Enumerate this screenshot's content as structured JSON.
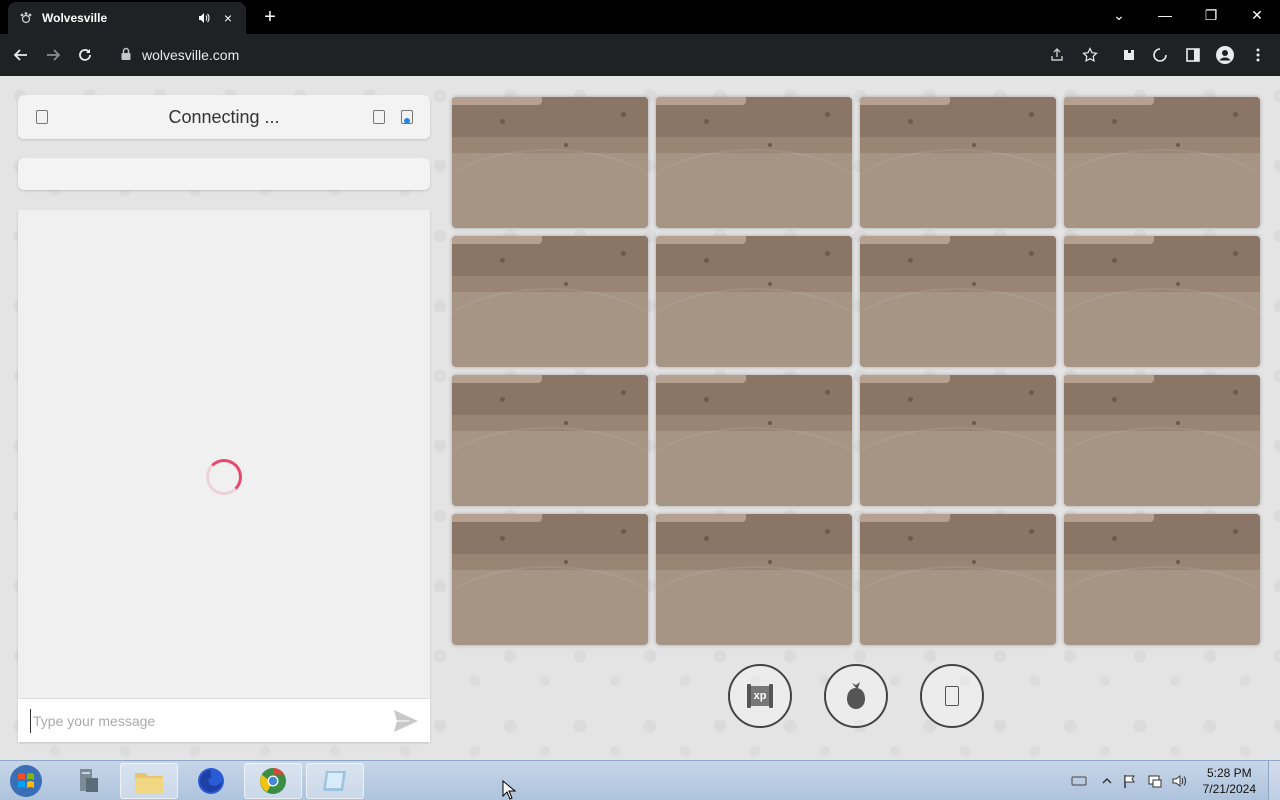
{
  "browser": {
    "tab_title": "Wolvesville",
    "tab_close_label": "×",
    "new_tab_label": "+",
    "url": "wolvesville.com"
  },
  "window_controls": {
    "dropdown": "⌄",
    "minimize": "—",
    "restore": "❐",
    "close": "✕"
  },
  "header": {
    "status": "Connecting ..."
  },
  "chat": {
    "placeholder": "Type your message"
  },
  "grid": {
    "card_count": 16
  },
  "actions": {
    "xp_label": "xp"
  },
  "taskbar": {
    "time": "5:28 PM",
    "date": "7/21/2024"
  },
  "colors": {
    "card": "#a69585",
    "card_top": "#8a7566",
    "spinner": "#e8486e",
    "page_bg": "#e4e4e4"
  }
}
